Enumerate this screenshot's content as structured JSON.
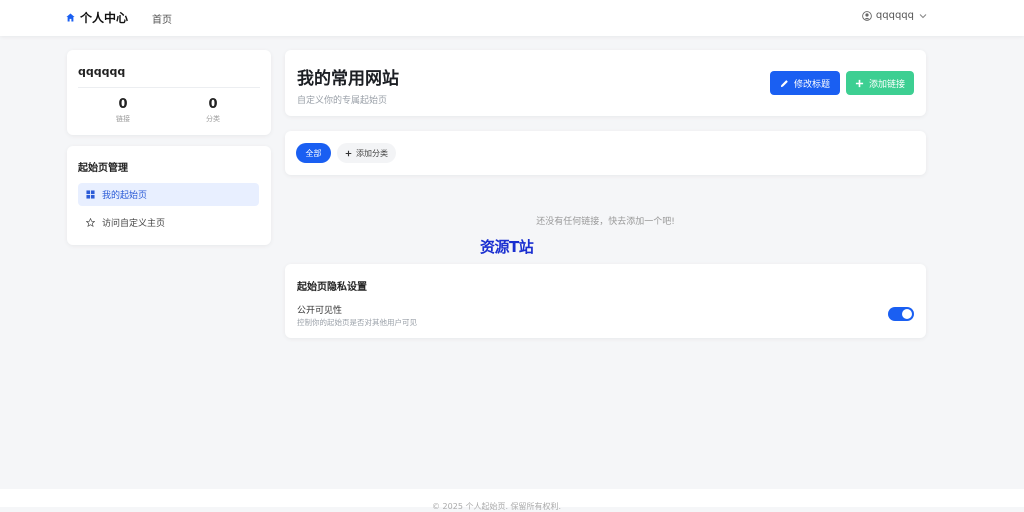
{
  "nav": {
    "brand": "个人中心",
    "home": "首页",
    "username": "qqqqqq"
  },
  "profile": {
    "name": "qqqqqq",
    "links_count": "0",
    "links_label": "链接",
    "categories_count": "0",
    "categories_label": "分类"
  },
  "manage": {
    "title": "起始页管理",
    "items": [
      {
        "label": "我的起始页",
        "icon": "grid-icon",
        "active": true
      },
      {
        "label": "访问自定义主页",
        "icon": "star-icon",
        "active": false
      }
    ]
  },
  "header": {
    "title": "我的常用网站",
    "subtitle": "自定义你的专属起始页",
    "edit_title_button": "修改标题",
    "add_link_button": "添加链接"
  },
  "filters": {
    "all": "全部",
    "add_category": "添加分类"
  },
  "empty": {
    "message": "还没有任何链接，快去添加一个吧!"
  },
  "watermark": "资源T站",
  "privacy": {
    "title": "起始页隐私设置",
    "label": "公开可见性",
    "description": "控制你的起始页是否对其他用户可见",
    "enabled": true
  },
  "footer": {
    "text": "© 2025 个人起始页. 保留所有权利."
  },
  "colors": {
    "primary": "#1a5ff2",
    "success": "#3dcf92",
    "background": "#f5f6f8"
  }
}
